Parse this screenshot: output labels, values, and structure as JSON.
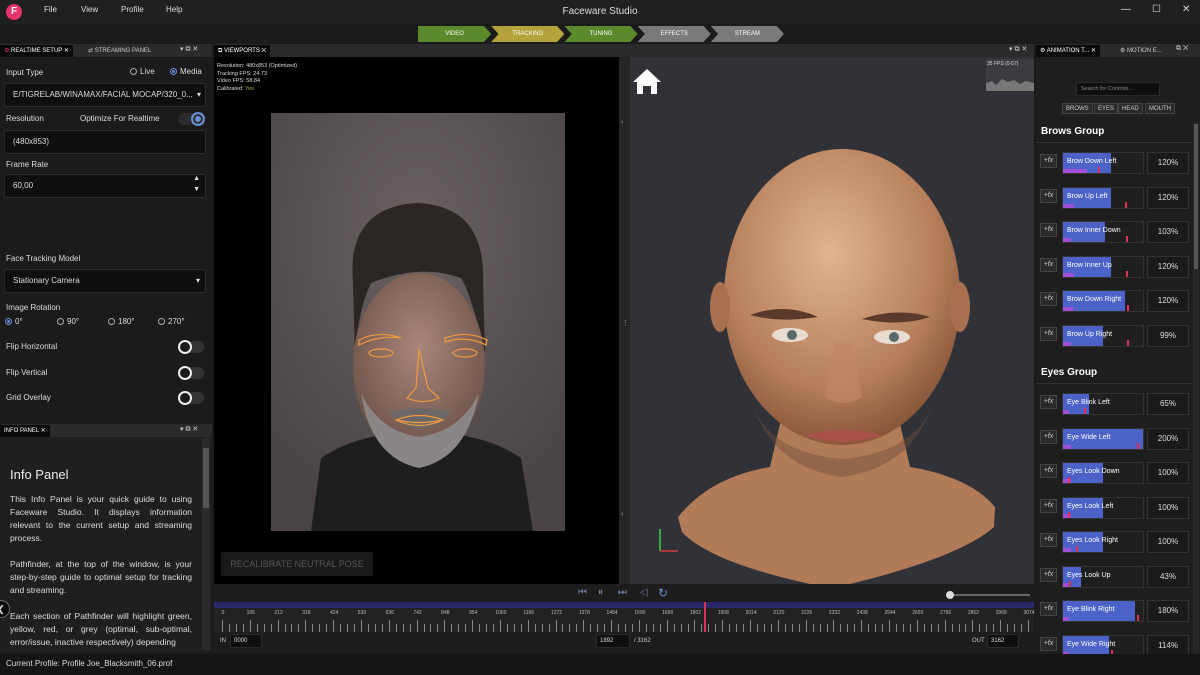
{
  "app": {
    "title": "Faceware Studio",
    "logo": "F",
    "menu": [
      "File",
      "View",
      "Profile",
      "Help"
    ],
    "win": {
      "min": "—",
      "max": "☐",
      "close": "✕"
    }
  },
  "pathfinder": [
    {
      "label": "VIDEO",
      "color": "#5b8a2c"
    },
    {
      "label": "TRACKING",
      "color": "#b4a23a"
    },
    {
      "label": "TUNING",
      "color": "#5b8a2c"
    },
    {
      "label": "EFFECTS",
      "color": "#7a7a7a"
    },
    {
      "label": "STREAM",
      "color": "#7a7a7a"
    }
  ],
  "left_tabs": [
    "REALTIME SETUP",
    "STREAMING PANEL"
  ],
  "setup": {
    "input_type_label": "Input Type",
    "live": "Live",
    "media": "Media",
    "path": "E/TIGRELAB/WINAMAX/FACIAL MOCAP/320_0...",
    "resolution_label": "Resolution",
    "optimize_label": "Optimize For Realtime",
    "resolution_value": "(480x853)",
    "frame_rate_label": "Frame Rate",
    "frame_rate_value": "60,00",
    "tracking_model_label": "Face Tracking Model",
    "tracking_model_value": "Stationary Camera",
    "rotation_label": "Image Rotation",
    "rotations": [
      "0°",
      "90°",
      "180°",
      "270°"
    ],
    "flip_h": "Flip Horizontal",
    "flip_v": "Flip Vertical",
    "grid_overlay": "Grid Overlay"
  },
  "info": {
    "tab": "INFO PANEL",
    "title": "Info Panel",
    "p1": "This Info Panel is your quick guide to using Faceware Studio. It displays information relevant to the current setup and streaming process.",
    "p2": "Pathfinder, at the top of the window, is your step-by-step guide to optimal setup for tracking and streaming.",
    "p3": "Each section of Pathfinder will highlight green, yellow, red, or grey (optimal, sub-optimal, error/issue, inactive respectively) depending"
  },
  "viewport": {
    "tab": "VIEWPORTS",
    "stats": [
      {
        "k": "Resolution:",
        "v": "480x853 (Optimized)"
      },
      {
        "k": "Tracking FPS:",
        "v": "24.73"
      },
      {
        "k": "Video FPS:",
        "v": "58.84"
      },
      {
        "k": "Calibrated:",
        "v": "Yes"
      }
    ],
    "recalibrate": "RECALIBRATE NEUTRAL POSE",
    "fps_graph": "35 FPS (0-57)"
  },
  "timeline": {
    "ticks": [
      "0",
      "106",
      "212",
      "318",
      "424",
      "530",
      "636",
      "742",
      "848",
      "954",
      "1060",
      "1166",
      "1272",
      "1378",
      "1484",
      "1590",
      "1696",
      "1802",
      "1908",
      "2014",
      "2120",
      "2226",
      "2332",
      "2438",
      "2544",
      "2650",
      "2756",
      "2862",
      "2968",
      "3074"
    ],
    "in_label": "IN",
    "in_value": "0000",
    "current": "1892",
    "total": "/ 3162",
    "out_label": "OUT",
    "out_value": "3162",
    "playhead": 0.598
  },
  "right_tabs": [
    "ANIMATION T...",
    "MOTION E..."
  ],
  "search_placeholder": "Search for Controls...",
  "filters": [
    "BROWS",
    "EYES",
    "HEAD",
    "MOUTH"
  ],
  "groups": [
    {
      "name": "Brows Group",
      "controls": [
        {
          "label": "Brow Down Left",
          "pct": "120%",
          "fill": 0.6,
          "sub": 0.3,
          "mark": 0.44
        },
        {
          "label": "Brow Up Left",
          "pct": "120%",
          "fill": 0.6,
          "sub": 0.14,
          "mark": 0.78
        },
        {
          "label": "Brow Inner Down",
          "pct": "103%",
          "fill": 0.52,
          "sub": 0.1,
          "mark": 0.79
        },
        {
          "label": "Brow Inner Up",
          "pct": "120%",
          "fill": 0.6,
          "sub": 0.14,
          "mark": 0.79
        },
        {
          "label": "Brow Down Right",
          "pct": "120%",
          "fill": 0.78,
          "sub": 0.12,
          "mark": 0.8
        },
        {
          "label": "Brow Up Right",
          "pct": "99%",
          "fill": 0.5,
          "sub": 0.1,
          "mark": 0.8
        }
      ]
    },
    {
      "name": "Eyes Group",
      "controls": [
        {
          "label": "Eye Blink Left",
          "pct": "65%",
          "fill": 0.33,
          "sub": 0.08,
          "mark": 0.26
        },
        {
          "label": "Eye Wide Left",
          "pct": "200%",
          "fill": 1.0,
          "sub": 0.1,
          "mark": 0.93
        },
        {
          "label": "Eyes Look Down",
          "pct": "100%",
          "fill": 0.5,
          "sub": 0.1,
          "mark": 0.06
        },
        {
          "label": "Eyes Look Left",
          "pct": "100%",
          "fill": 0.5,
          "sub": 0.1,
          "mark": 0.06
        },
        {
          "label": "Eyes Look Right",
          "pct": "100%",
          "fill": 0.5,
          "sub": 0.1,
          "mark": 0.16
        },
        {
          "label": "Eyes Look Up",
          "pct": "43%",
          "fill": 0.22,
          "sub": 0.06,
          "mark": 0.07
        },
        {
          "label": "Eye Blink Right",
          "pct": "180%",
          "fill": 0.9,
          "sub": 0.08,
          "mark": 0.93
        },
        {
          "label": "Eye Wide Right",
          "pct": "114%",
          "fill": 0.57,
          "sub": 0.08,
          "mark": 0.6
        }
      ]
    }
  ],
  "status": "Current Profile: Profile Joe_Blacksmith_06.prof",
  "colors": {
    "accent": "#4b63c9",
    "landmark": "#f09a3e",
    "purple": "#a14fd8",
    "marker": "#e0305a"
  }
}
